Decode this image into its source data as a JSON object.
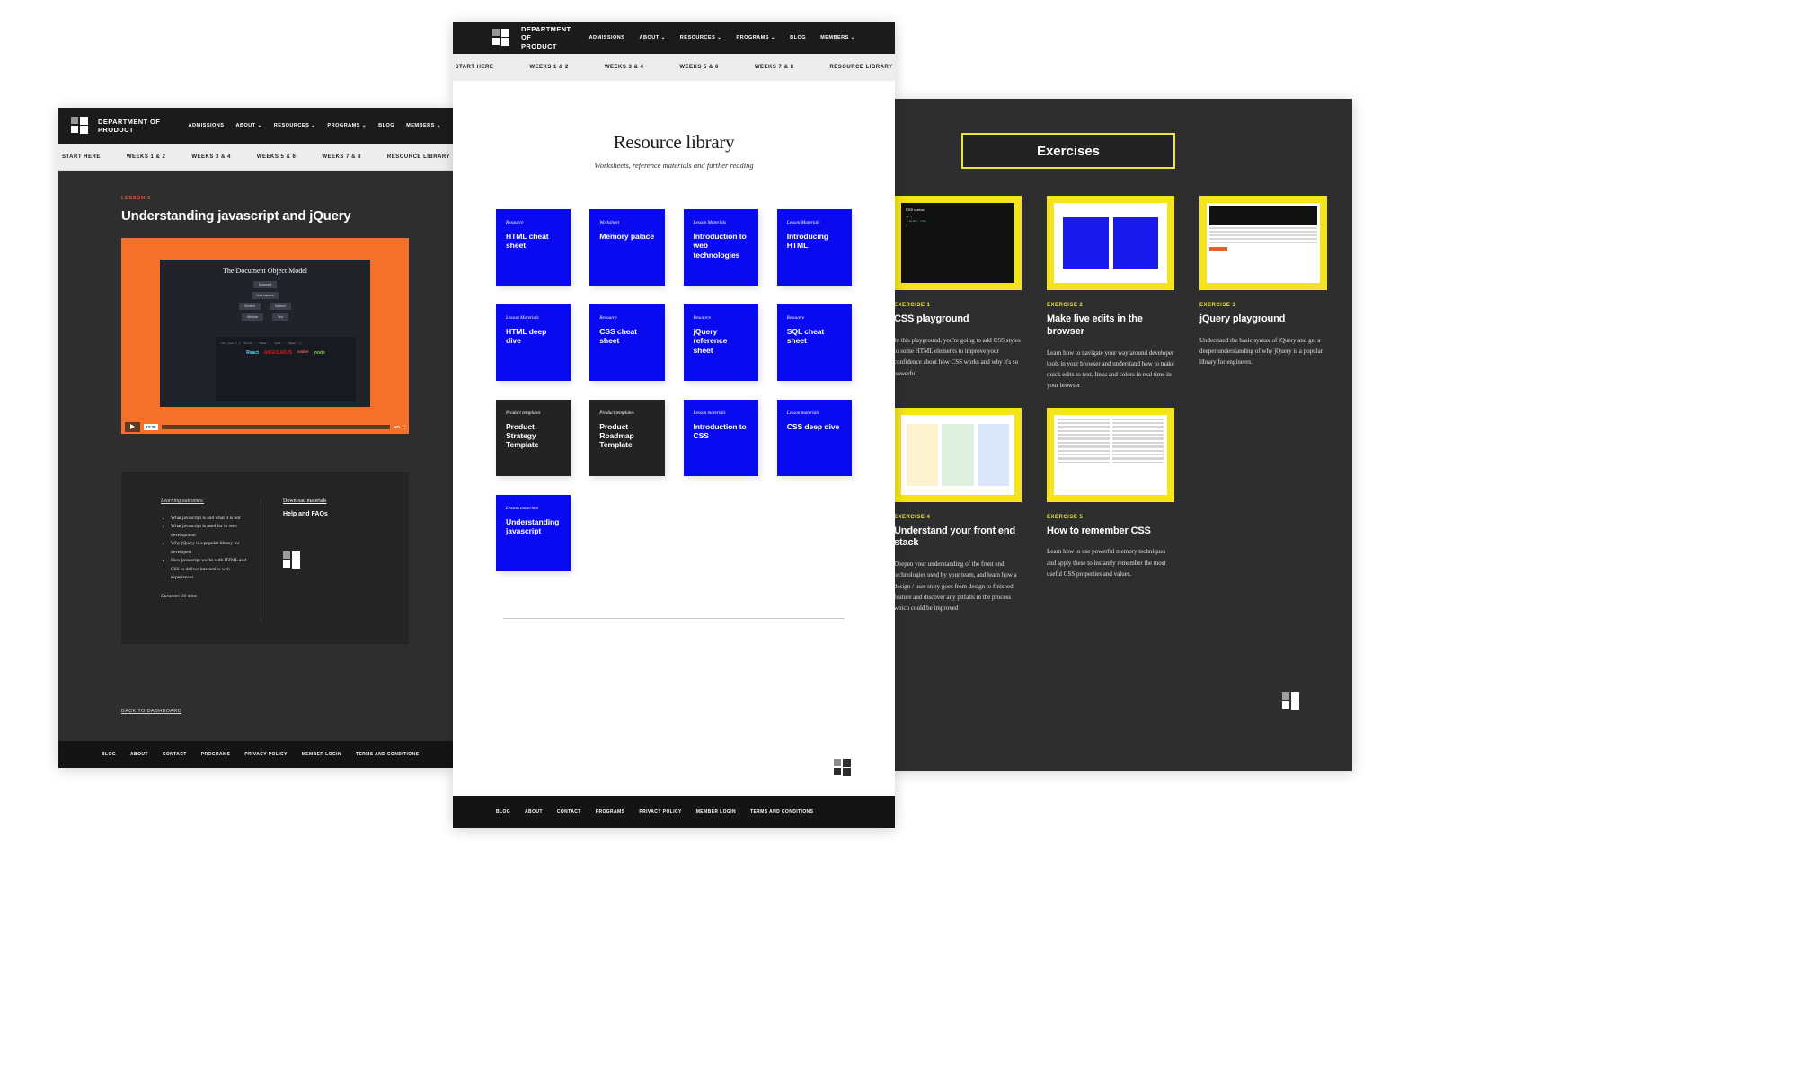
{
  "brand": {
    "line1": "DEPARTMENT OF",
    "line2": "PRODUCT"
  },
  "nav": [
    {
      "label": "ADMISSIONS",
      "caret": false
    },
    {
      "label": "ABOUT",
      "caret": true
    },
    {
      "label": "RESOURCES",
      "caret": true
    },
    {
      "label": "PROGRAMS",
      "caret": true
    },
    {
      "label": "BLOG",
      "caret": false
    },
    {
      "label": "MEMBERS",
      "caret": true
    }
  ],
  "subnav": [
    "START HERE",
    "WEEKS 1 & 2",
    "WEEKS 3 & 4",
    "WEEKS 5 & 6",
    "WEEKS 7 & 8",
    "RESOURCE LIBRARY"
  ],
  "footer_links": [
    "BLOG",
    "ABOUT",
    "CONTACT",
    "PROGRAMS",
    "PRIVACY POLICY",
    "MEMBER LOGIN",
    "TERMS AND CONDITIONS"
  ],
  "colors": {
    "blue": "#0a0af0",
    "yellow": "#f5e31b",
    "orange": "#f4712c",
    "dark": "#2e2e2e",
    "near_black": "#1b1b1b"
  },
  "lesson": {
    "eyebrow": "LESSON 3",
    "title": "Understanding javascript and jQuery",
    "video": {
      "screen_title": "The Document Object Model",
      "dom_nodes": [
        "Document",
        "Root element\n<html>",
        "Element\n<head>",
        "Element\n<body>",
        "Attribute\nhref"
      ],
      "code_snippet": "var json = { 'first' : 'Name' , 'last' : 'Name' };",
      "libraries": [
        "React",
        "ANGULARJS",
        "ember",
        "node"
      ],
      "timestamp": "13:35",
      "quality": "HD"
    },
    "outcomes_label": "Learning outcomes:",
    "outcomes": [
      "What javascript is and what it is not",
      "What javascript is used for in web development",
      "Why jQuery is a popular library for developers",
      "How javascript works with HTML and CSS to deliver interactive web experiences"
    ],
    "duration": "Duration: 30 mins",
    "download_label": "Download materials",
    "help_label": "Help and FAQs",
    "back_label": "BACK TO DASHBOARD"
  },
  "library": {
    "title": "Resource library",
    "subtitle": "Worksheets, reference materials and further reading",
    "cards": [
      {
        "kicker": "Resource",
        "title": "HTML cheat sheet",
        "style": "blue"
      },
      {
        "kicker": "Worksheet",
        "title": "Memory palace",
        "style": "blue"
      },
      {
        "kicker": "Lesson Materials",
        "title": "Introduction to web technologies",
        "style": "blue"
      },
      {
        "kicker": "Lesson Materials",
        "title": "Introducing HTML",
        "style": "blue"
      },
      {
        "kicker": "Lesson Materials",
        "title": "HTML deep dive",
        "style": "blue"
      },
      {
        "kicker": "Resource",
        "title": "CSS cheat sheet",
        "style": "blue"
      },
      {
        "kicker": "Resource",
        "title": "jQuery reference sheet",
        "style": "blue"
      },
      {
        "kicker": "Resource",
        "title": "SQL cheat sheet",
        "style": "blue"
      },
      {
        "kicker": "Product templates",
        "title": "Product Strategy Template",
        "style": "dark"
      },
      {
        "kicker": "Product templates",
        "title": "Product Roadmap Template",
        "style": "dark"
      },
      {
        "kicker": "Lesson materials",
        "title": "Introduction to CSS",
        "style": "blue"
      },
      {
        "kicker": "Lesson materials",
        "title": "CSS deep dive",
        "style": "blue"
      },
      {
        "kicker": "Lesson materials",
        "title": "Understanding javascript",
        "style": "blue"
      }
    ]
  },
  "exercises": {
    "heading": "Exercises",
    "items": [
      {
        "kicker": "EXERCISE 1",
        "title": "CSS playground",
        "desc": "In this playground, you're going to add CSS styles to some HTML elements to improve your confidence about how CSS works and why it's so powerful.",
        "thumb": "css-syntax-thumb"
      },
      {
        "kicker": "EXERCISE 2",
        "title": "Make live edits in the browser",
        "desc": "Learn how to navigate your way around developer tools in your browser and understand how to make quick edits to text, links and colors in real time in your browser",
        "thumb": "browser-thumb"
      },
      {
        "kicker": "EXERCISE 3",
        "title": "jQuery playground",
        "desc": "Understand the basic syntax of jQuery and get a deeper understanding of why jQuery is a popular library for engineers.",
        "thumb": "jquery-thumb"
      },
      {
        "kicker": "EXERCISE 4",
        "title": "Understand your front end stack",
        "desc": "Deepen your understanding of the front end technologies used by your team, and learn how a design / user story goes from design to finished feature and discover any pitfalls in the process which could be improved",
        "thumb": "stack-thumb"
      },
      {
        "kicker": "EXERCISE 5",
        "title": "How to remember CSS",
        "desc": "Learn how to use powerful memory techniques and apply these to instantly remember the most useful CSS properties and values.",
        "thumb": "table-thumb"
      }
    ]
  }
}
